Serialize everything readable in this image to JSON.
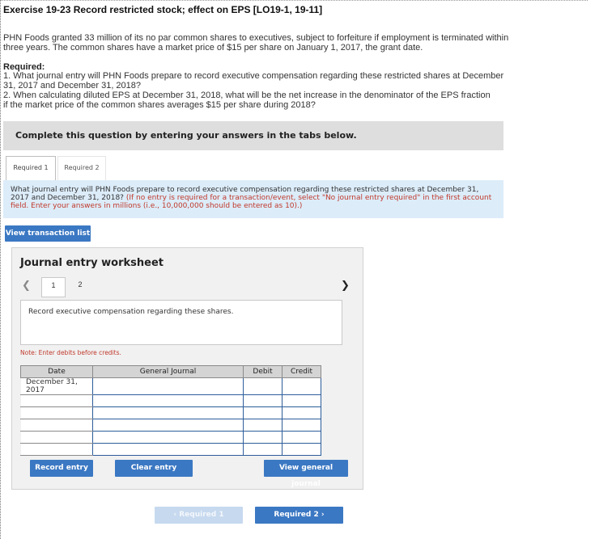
{
  "exercise": {
    "title": "Exercise 19-23 Record restricted stock; effect on EPS [LO19-1, 19-11]",
    "scenario": "PHN Foods granted 33 million of its no par common shares to executives, subject to forfeiture if employment is terminated within three years. The common shares have a market price of $15 per share on January 1, 2017, the grant date.",
    "required_label": "Required:",
    "required_1": "1. What journal entry will PHN Foods prepare to record executive compensation regarding these restricted shares at December 31, 2017 and December 31, 2018?",
    "required_2": "2. When calculating diluted EPS at December 31, 2018, what will be the net increase in the denominator of the EPS fraction if the market price of the common shares averages $15 per share during 2018?"
  },
  "banner": {
    "text": "Complete this question by entering your answers in the tabs below."
  },
  "tabs": [
    {
      "label": "Required 1",
      "active": true
    },
    {
      "label": "Required 2",
      "active": false
    }
  ],
  "question": {
    "text": "What journal entry will PHN Foods prepare to record executive compensation regarding these restricted shares at December 31, 2017 and December 31, 2018?",
    "instruction": "(If no entry is required for a transaction/event, select \"No journal entry required\" in the first account field. Enter your answers in millions (i.e., 10,000,000 should be entered as 10).)"
  },
  "buttons": {
    "view_transaction_list": "View transaction list",
    "record_entry": "Record entry",
    "clear_entry": "Clear entry",
    "view_general_journal": "View general journal",
    "prev_tab": "Required 1",
    "next_tab": "Required 2"
  },
  "worksheet": {
    "title": "Journal entry worksheet",
    "pages": [
      "1",
      "2"
    ],
    "current_page": "1",
    "description": "Record executive compensation regarding these shares.",
    "note": "Note: Enter debits before credits.",
    "columns": [
      "Date",
      "General Journal",
      "Debit",
      "Credit"
    ],
    "rows": [
      {
        "date": "December 31, 2017"
      },
      {
        "date": ""
      },
      {
        "date": ""
      },
      {
        "date": ""
      },
      {
        "date": ""
      },
      {
        "date": ""
      }
    ]
  },
  "colors": {
    "primary_button": "#3b78c3",
    "question_bg": "#dcecf9",
    "note_red": "#c0392b"
  },
  "icons": {
    "prev": "chevron-left-icon",
    "next": "chevron-right-icon"
  }
}
